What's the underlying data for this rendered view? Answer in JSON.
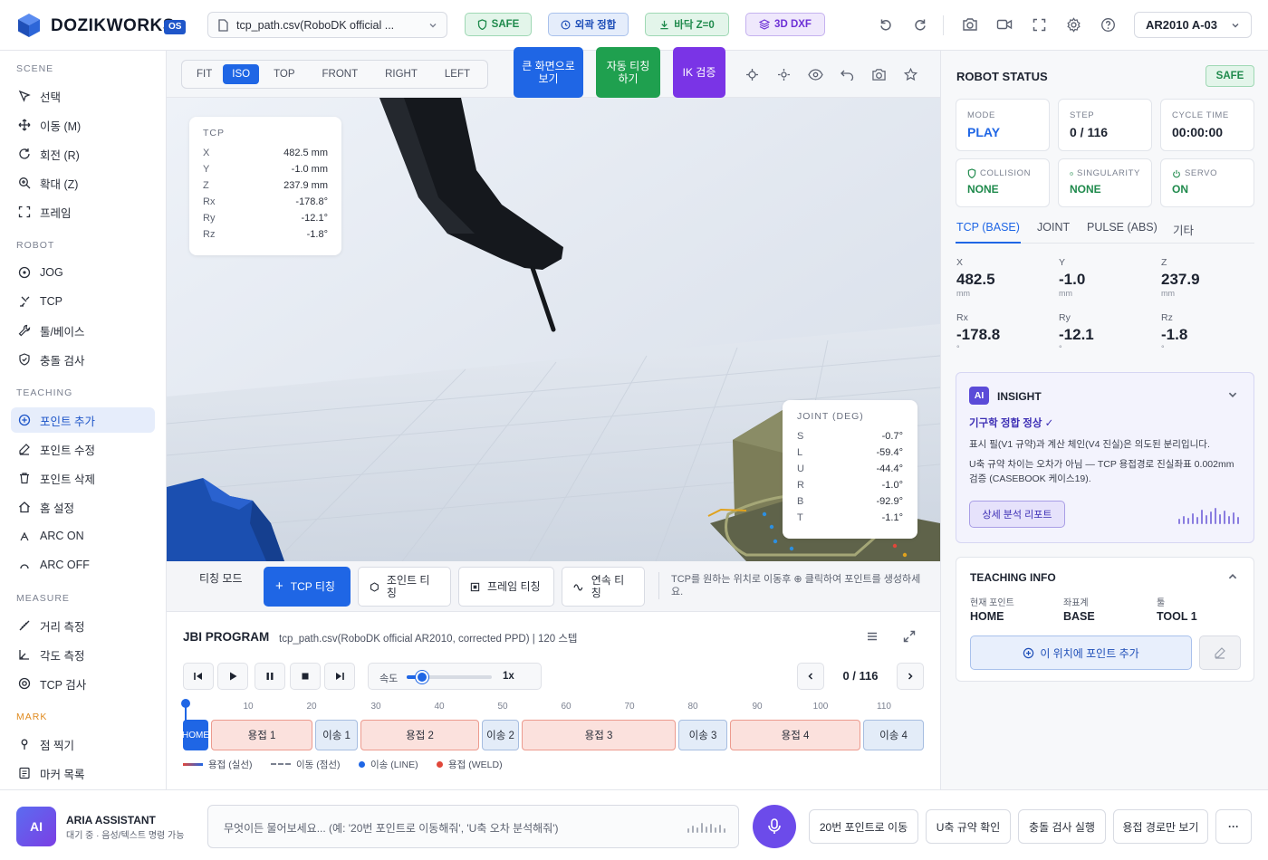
{
  "app": {
    "name": "DOZIKWORKS",
    "version_badge": "OS"
  },
  "file_select": {
    "value": "tcp_path.csv(RoboDK official ..."
  },
  "status_chips": {
    "safe": "SAFE",
    "align": "외곽 정합",
    "floor": "바닥 Z=0",
    "dxf": "3D DXF"
  },
  "robot_select": {
    "value": "AR2010 A-03"
  },
  "colors": {
    "accent": "#1f66e5",
    "safe_green": "#1f9d55",
    "weld_red": "#e0473a",
    "purple": "#7c3aed"
  },
  "sidebar": {
    "scene": {
      "title": "SCENE",
      "items": [
        "선택",
        "이동 (M)",
        "회전 (R)",
        "확대 (Z)",
        "프레임"
      ]
    },
    "robot": {
      "title": "ROBOT",
      "items": [
        "JOG",
        "TCP",
        "툴/베이스",
        "충돌 검사"
      ]
    },
    "teaching": {
      "title": "TEACHING",
      "items": [
        "포인트 추가",
        "포인트 수정",
        "포인트 삭제",
        "홈 설정",
        "ARC ON",
        "ARC OFF"
      ]
    },
    "measure": {
      "title": "MEASURE",
      "items": [
        "거리 측정",
        "각도 측정",
        "TCP 검사"
      ]
    },
    "mark": {
      "title": "MARK",
      "items": [
        "점 찍기",
        "마커 목록"
      ]
    }
  },
  "view_tabs": [
    "FIT",
    "ISO",
    "TOP",
    "FRONT",
    "RIGHT",
    "LEFT"
  ],
  "view_tab_active": "ISO",
  "view_buttons": {
    "fullscreen": "큰 화면으로 보기",
    "auto_teach": "자동 티칭 하기",
    "ik": "IK 검증"
  },
  "tcp_overlay": {
    "title": "TCP",
    "rows": [
      {
        "k": "X",
        "v": "482.5 mm"
      },
      {
        "k": "Y",
        "v": "-1.0 mm"
      },
      {
        "k": "Z",
        "v": "237.9 mm"
      },
      {
        "k": "Rx",
        "v": "-178.8°"
      },
      {
        "k": "Ry",
        "v": "-12.1°"
      },
      {
        "k": "Rz",
        "v": "-1.8°"
      }
    ]
  },
  "joint_overlay": {
    "title": "JOINT (DEG)",
    "rows": [
      {
        "k": "S",
        "v": "-0.7°"
      },
      {
        "k": "L",
        "v": "-59.4°"
      },
      {
        "k": "U",
        "v": "-44.4°"
      },
      {
        "k": "R",
        "v": "-1.0°"
      },
      {
        "k": "B",
        "v": "-92.9°"
      },
      {
        "k": "T",
        "v": "-1.1°"
      }
    ]
  },
  "teach_modes": {
    "mode_label": "티칭 모드",
    "tcp": "TCP 티칭",
    "joint": "조인트 티칭",
    "frame": "프레임 티칭",
    "continuous": "연속 티칭",
    "hint": "TCP를 원하는 위치로 이동후 ⊕ 클릭하여 포인트를 생성하세요."
  },
  "program": {
    "title": "JBI PROGRAM",
    "subtitle": "tcp_path.csv(RoboDK official AR2010, corrected PPD) | 120 스텝",
    "speed_label": "속도",
    "speed_value": "1x",
    "speed_fraction": 0.18,
    "step": "0 / 116",
    "ticks": [
      "10",
      "20",
      "30",
      "40",
      "50",
      "60",
      "70",
      "80",
      "90",
      "100",
      "110"
    ],
    "segments": [
      {
        "label": "HOME",
        "kind": "home"
      },
      {
        "label": "용접 1",
        "kind": "weld"
      },
      {
        "label": "이송 1",
        "kind": "move"
      },
      {
        "label": "용접 2",
        "kind": "weld"
      },
      {
        "label": "이송 2",
        "kind": "move"
      },
      {
        "label": "용접 3",
        "kind": "weld"
      },
      {
        "label": "이송 3",
        "kind": "move"
      },
      {
        "label": "용접 4",
        "kind": "weld"
      },
      {
        "label": "이송 4",
        "kind": "move"
      }
    ],
    "legend": {
      "weld_solid": "용접 (실선)",
      "move_dash": "이동 (점선)",
      "move_line": "이송 (LINE)",
      "weld_pt": "용접 (WELD)"
    }
  },
  "robot_status": {
    "title": "ROBOT STATUS",
    "safe": "SAFE",
    "mode": {
      "label": "MODE",
      "value": "PLAY"
    },
    "step": {
      "label": "STEP",
      "value": "0 / 116"
    },
    "cycle": {
      "label": "CYCLE TIME",
      "value": "00:00:00"
    },
    "collision": {
      "label": "COLLISION",
      "value": "NONE"
    },
    "singularity": {
      "label": "SINGULARITY",
      "value": "NONE"
    },
    "servo": {
      "label": "SERVO",
      "value": "ON"
    }
  },
  "coord_tabs": [
    "TCP (BASE)",
    "JOINT",
    "PULSE (ABS)",
    "기타"
  ],
  "coords": [
    {
      "k": "X",
      "v": "482.5",
      "u": "mm"
    },
    {
      "k": "Y",
      "v": "-1.0",
      "u": "mm"
    },
    {
      "k": "Z",
      "v": "237.9",
      "u": "mm"
    },
    {
      "k": "Rx",
      "v": "-178.8",
      "u": "°"
    },
    {
      "k": "Ry",
      "v": "-12.1",
      "u": "°"
    },
    {
      "k": "Rz",
      "v": "-1.8",
      "u": "°"
    }
  ],
  "insight": {
    "badge": "AI",
    "title": "INSIGHT",
    "status": "기구학 정합 정상 ✓",
    "line1": "표시 필(V1 규약)과 계산 체인(V4 진실)은 의도된 분리입니다.",
    "line2": "U축 규약 차이는 오차가 아님 — TCP 용접경로 진실좌표 0.002mm 검증 (CASEBOOK 케이스19).",
    "button": "상세 분석 리포트"
  },
  "teaching_info": {
    "title": "TEACHING INFO",
    "current_label": "현재 포인트",
    "current": "HOME",
    "frame_label": "좌표계",
    "frame": "BASE",
    "tool_label": "툴",
    "tool": "TOOL 1",
    "add_button": "이 위치에 포인트 추가"
  },
  "assistant": {
    "badge": "AI",
    "name": "ARIA ASSISTANT",
    "sub": "대기 중 · 음성/텍스트 명령 가능",
    "placeholder": "무엇이든 물어보세요... (예: '20번 포인트로 이동해줘', 'U축 오차 분석해줘')",
    "quick": [
      "20번 포인트로 이동",
      "U축 규약 확인",
      "충돌 검사 실행",
      "용접 경로만 보기"
    ],
    "more": "···"
  }
}
